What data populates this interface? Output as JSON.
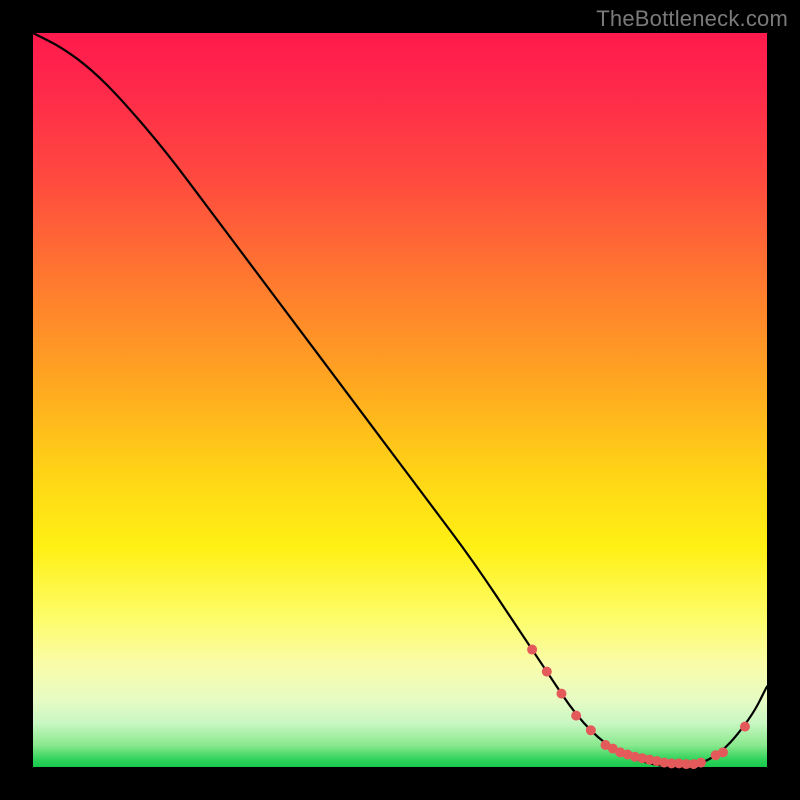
{
  "attribution": "TheBottleneck.com",
  "chart_data": {
    "type": "line",
    "title": "",
    "xlabel": "",
    "ylabel": "",
    "xlim": [
      0,
      100
    ],
    "ylim": [
      0,
      100
    ],
    "grid": false,
    "legend": false,
    "series": [
      {
        "name": "bottleneck-curve",
        "color": "#000000",
        "x": [
          0,
          4,
          8,
          12,
          18,
          24,
          30,
          36,
          42,
          48,
          54,
          60,
          66,
          70,
          74,
          78,
          82,
          86,
          90,
          94,
          98,
          100
        ],
        "y": [
          100,
          98,
          95,
          91,
          84,
          76,
          68,
          60,
          52,
          44,
          36,
          28,
          19,
          13,
          7,
          3,
          1,
          0,
          0,
          2,
          7,
          11
        ]
      }
    ],
    "marker_cluster": {
      "name": "highlighted-points",
      "color": "#e45a5a",
      "radius_px": 5,
      "x": [
        68,
        70,
        72,
        74,
        76,
        78,
        79,
        80,
        81,
        82,
        83,
        84,
        85,
        86,
        87,
        88,
        89,
        90,
        91,
        93,
        94,
        97
      ],
      "y": [
        16,
        13,
        10,
        7,
        5,
        3,
        2.5,
        2,
        1.7,
        1.4,
        1.2,
        1,
        0.8,
        0.6,
        0.5,
        0.5,
        0.4,
        0.4,
        0.6,
        1.6,
        2,
        5.5
      ]
    }
  }
}
